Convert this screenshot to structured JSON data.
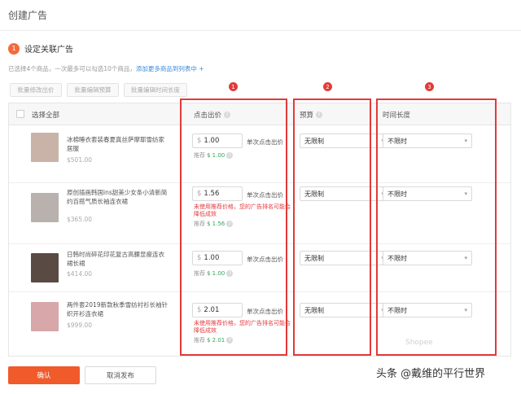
{
  "header": {
    "title": "创建广告"
  },
  "step": {
    "number": "1",
    "label": "设定关联广告"
  },
  "info": {
    "text": "已选择4个商品，一次最多可以勾选10个商品，",
    "link": "添加更多商品到列表中 +"
  },
  "batch_buttons": [
    "批量修改出价",
    "批量编辑预算",
    "批量编辑时间长度"
  ],
  "table": {
    "select_all": "选择全部",
    "col_bid": "点击出价",
    "col_budget": "预算",
    "col_duration": "时间长度",
    "bid_unit": "单次点击出价",
    "suggest_label": "推荐",
    "warning": "未使用推荐价格，您的广告排名可能会降低成效",
    "rows": [
      {
        "name": "冰棉睡衣套装春夏真丝萨摩耶雪纺家居服",
        "price": "$501.00",
        "bid": "1.00",
        "suggest": "$ 1.00",
        "budget": "无限制",
        "duration": "不限时",
        "thumb": "#c9b3a8",
        "warn": false
      },
      {
        "name": "原创插画韩国ins甜美少女条小清新简约百搭气质长袖连衣裙",
        "price": "$365.00",
        "bid": "1.56",
        "suggest": "$ 1.56",
        "budget": "无限制",
        "duration": "不限时",
        "thumb": "#b9b1ad",
        "warn": true
      },
      {
        "name": "日韩时尚碎花印花复古高腰显瘦连衣裙长裙",
        "price": "$414.00",
        "bid": "1.00",
        "suggest": "$ 1.00",
        "budget": "无限制",
        "duration": "不限时",
        "thumb": "#5a4a44",
        "warn": false
      },
      {
        "name": "两件套2019新款秋季雪纺衬衫长袖针织开衫连衣裙",
        "price": "$999.00",
        "bid": "2.01",
        "suggest": "$ 2.01",
        "budget": "无限制",
        "duration": "不限时",
        "thumb": "#d7a7a9",
        "warn": true
      }
    ]
  },
  "annotations": [
    "1",
    "2",
    "3"
  ],
  "buttons": {
    "confirm": "确认",
    "cancel": "取消发布"
  },
  "watermark": {
    "main": "头条 @戴维的平行世界",
    "faint": "Shopee"
  },
  "colors": {
    "accent": "#f15a2b",
    "highlight": "#e23a38",
    "link": "#3c8bd9",
    "suggest": "#35a35a",
    "warning": "#e4393c"
  }
}
